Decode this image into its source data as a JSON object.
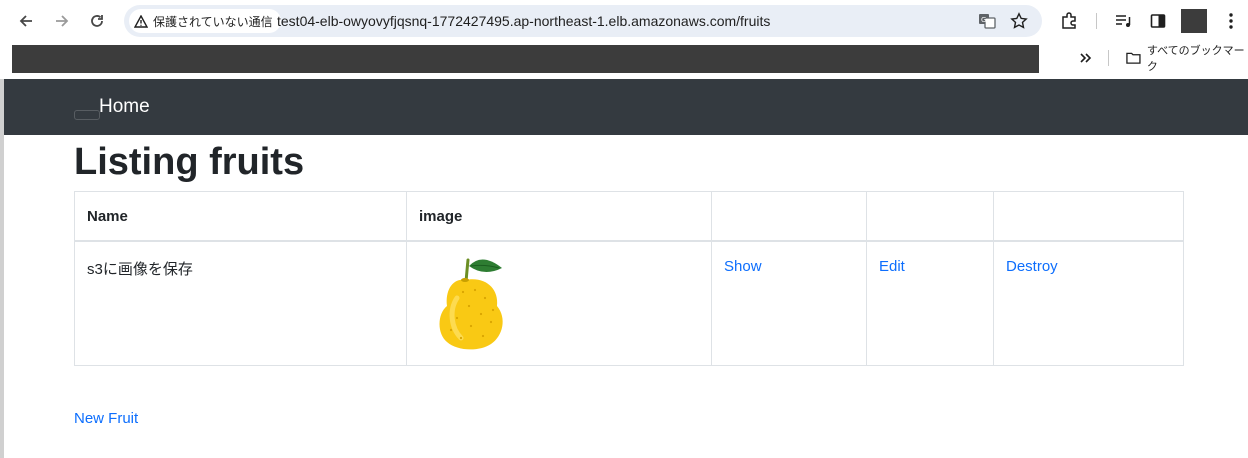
{
  "browser": {
    "security_chip": "保護されていない通信",
    "url": "test04-elb-owyovyfjqsnq-1772427495.ap-northeast-1.elb.amazonaws.com/fruits",
    "bookmarks_all": "すべてのブックマーク",
    "icons": [
      "back-icon",
      "forward-icon",
      "reload-icon",
      "warning-icon",
      "translate-icon",
      "star-icon",
      "extensions-icon",
      "media-icon",
      "side-panel-icon",
      "profile-avatar",
      "menu-icon",
      "chevron-double-right-icon",
      "folder-icon"
    ]
  },
  "navbar": {
    "brand": "Home",
    "color": "#343a40"
  },
  "page": {
    "title": "Listing fruits",
    "new_link": "New Fruit",
    "link_color": "#0d6efd"
  },
  "table": {
    "headers": [
      "Name",
      "image",
      "",
      "",
      ""
    ],
    "rows": [
      {
        "name": "s3に画像を保存",
        "image": "yuzu-fruit-image",
        "show": "Show",
        "edit": "Edit",
        "destroy": "Destroy"
      }
    ]
  }
}
